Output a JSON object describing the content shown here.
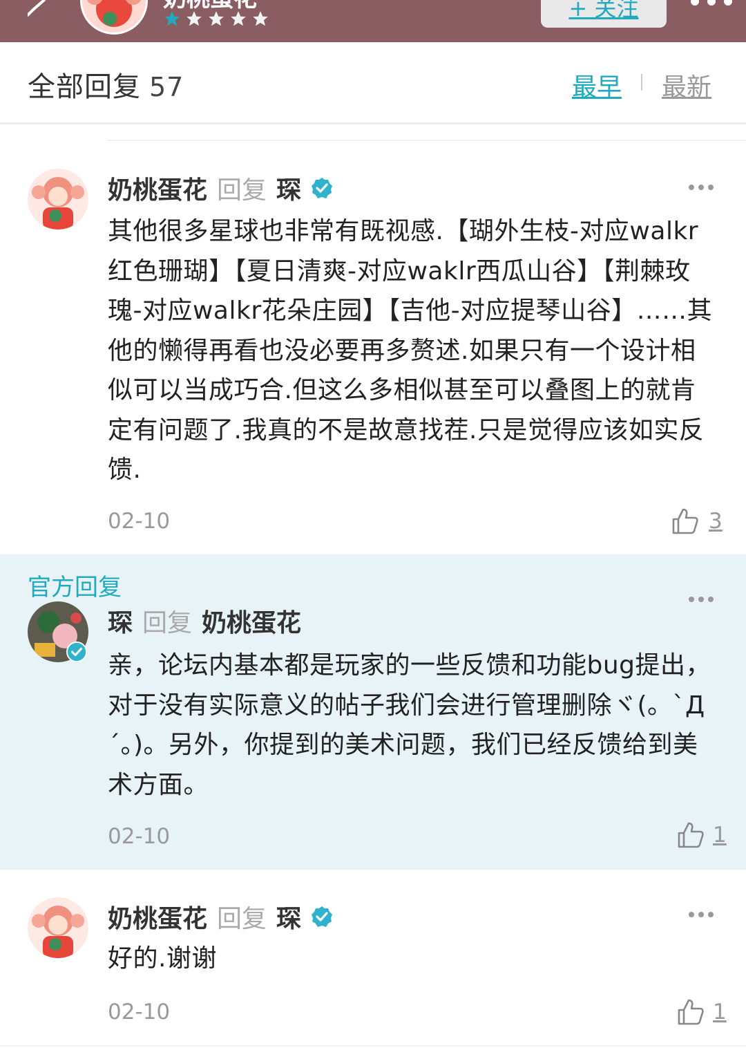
{
  "header": {
    "user_name": "奶桃蛋花",
    "follow_label": "+ 关注",
    "rating_stars": 5,
    "accent_color": "#20aac0",
    "bar_color": "#8a5d62"
  },
  "replies": {
    "title": "全部回复",
    "count": "57",
    "sort_earliest": "最早",
    "sort_latest": "最新"
  },
  "comments": [
    {
      "author": "奶桃蛋花",
      "reply_word": "回复",
      "target": "琛",
      "content": "其他很多星球也非常有既视感.【瑚外生枝-对应walkr红色珊瑚】【夏日清爽-对应waklr西瓜山谷】【荆棘玫瑰-对应walkr花朵庄园】【吉他-对应提琴山谷】……其他的懒得再看也没必要再多赘述.如果只有一个设计相似可以当成巧合.但这么多相似甚至可以叠图上的就肯定有问题了.我真的不是故意找茬.只是觉得应该如实反馈.",
      "date": "02-10",
      "likes": "3"
    },
    {
      "label": "官方回复",
      "author": "琛",
      "reply_word": "回复",
      "target": "奶桃蛋花",
      "content": "亲，论坛内基本都是玩家的一些反馈和功能bug提出，对于没有实际意义的帖子我们会进行管理删除ヾ(。`Д´。)。另外，你提到的美术问题，我们已经反馈给到美术方面。",
      "date": "02-10",
      "likes": "1"
    },
    {
      "author": "奶桃蛋花",
      "reply_word": "回复",
      "target": "琛",
      "content": "好的.谢谢",
      "date": "02-10",
      "likes": "1"
    }
  ]
}
